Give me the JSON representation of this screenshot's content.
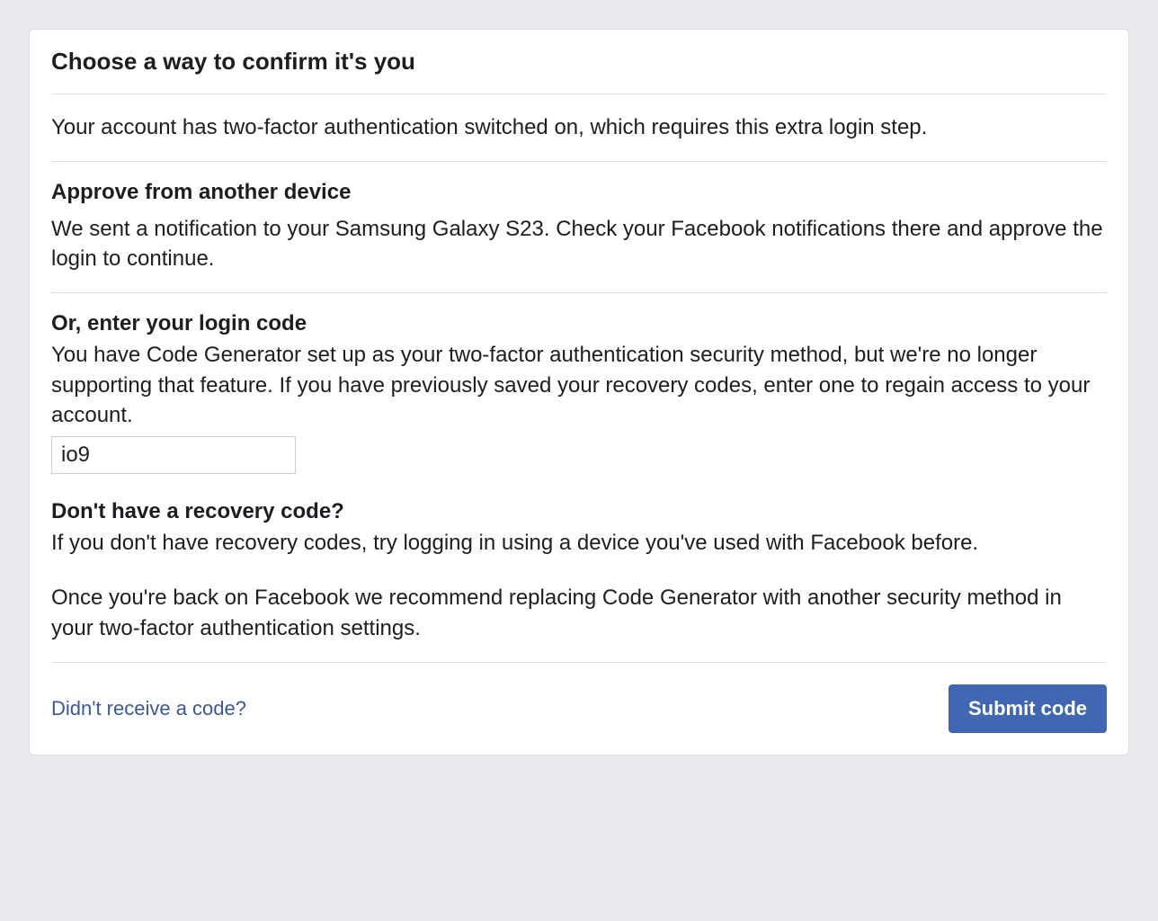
{
  "header": {
    "title": "Choose a way to confirm it's you"
  },
  "intro": {
    "text": "Your account has two-factor authentication switched on, which requires this extra login step."
  },
  "approve": {
    "heading": "Approve from another device",
    "text": "We sent a notification to your Samsung Galaxy S23. Check your Facebook notifications there and approve the login to continue."
  },
  "code_entry": {
    "heading": "Or, enter your login code",
    "text": "You have Code Generator set up as your two-factor authentication security method, but we're no longer supporting that feature. If you have previously saved your recovery codes, enter one to regain access to your account.",
    "input_value": "io9"
  },
  "no_code": {
    "heading": "Don't have a recovery code?",
    "text1": "If you don't have recovery codes, try logging in using a device you've used with Facebook before.",
    "text2": "Once you're back on Facebook we recommend replacing Code Generator with another security method in your two-factor authentication settings."
  },
  "footer": {
    "resend_label": "Didn't receive a code?",
    "submit_label": "Submit code"
  }
}
